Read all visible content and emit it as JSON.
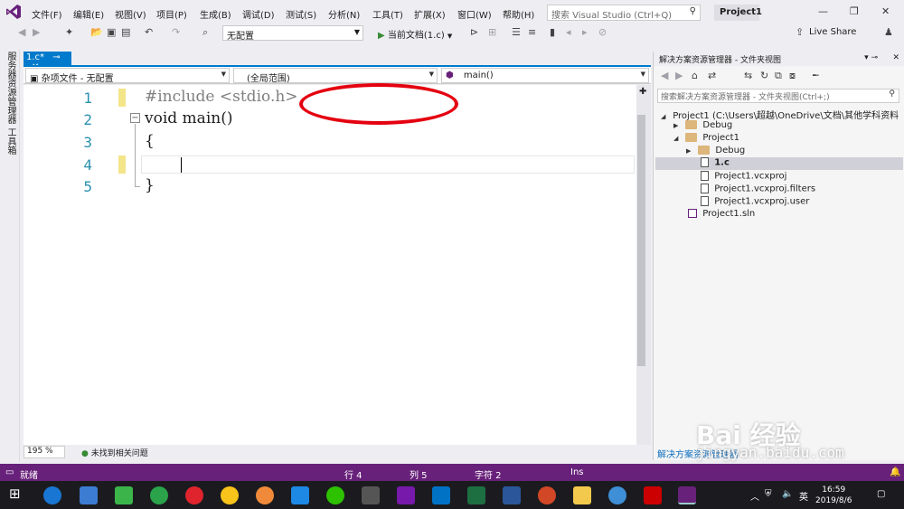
{
  "menubar": {
    "items": [
      "文件(F)",
      "编辑(E)",
      "视图(V)",
      "项目(P)",
      "生成(B)",
      "调试(D)",
      "测试(S)",
      "分析(N)",
      "工具(T)",
      "扩展(X)",
      "窗口(W)",
      "帮助(H)"
    ],
    "search_placeholder": "搜索 Visual Studio (Ctrl+Q)",
    "project_name": "Project1"
  },
  "toolbar": {
    "config": "无配置",
    "run_label": "当前文档(1.c)",
    "live_share": "Live Share"
  },
  "left_tabs": [
    "服务器资源管理器",
    "工具箱"
  ],
  "editor": {
    "tab_label": "1.c*",
    "nav_project": "杂项文件 - 无配置",
    "nav_scope": "(全局范围)",
    "nav_member": "main()",
    "lines": [
      {
        "num": "1",
        "text": "#include <stdio.h>"
      },
      {
        "num": "2",
        "text": "void main()"
      },
      {
        "num": "3",
        "text": "{"
      },
      {
        "num": "4",
        "text": ""
      },
      {
        "num": "5",
        "text": "}"
      }
    ],
    "zoom": "195 %",
    "issues": "未找到相关问题"
  },
  "solution_explorer": {
    "title": "解决方案资源管理器 - 文件夹视图",
    "search_placeholder": "搜索解决方案资源管理器 - 文件夹视图(Ctrl+;)",
    "tree": [
      {
        "label": "Project1 (C:\\Users\\超越\\OneDrive\\文档\\其他学科资料",
        "type": "proj"
      },
      {
        "label": "Debug",
        "type": "folder"
      },
      {
        "label": "Project1",
        "type": "folder"
      },
      {
        "label": "Debug",
        "type": "folder"
      },
      {
        "label": "1.c",
        "type": "file"
      },
      {
        "label": "Project1.vcxproj",
        "type": "file"
      },
      {
        "label": "Project1.vcxproj.filters",
        "type": "file"
      },
      {
        "label": "Project1.vcxproj.user",
        "type": "file"
      },
      {
        "label": "Project1.sln",
        "type": "sln"
      }
    ],
    "bottom_tab": "解决方案资源管理器"
  },
  "statusbar": {
    "ready": "就绪",
    "line": "行 4",
    "col": "列 5",
    "char": "字符 2",
    "ins": "Ins"
  },
  "taskbar": {
    "ime": "英",
    "time": "16:59",
    "date": "2019/8/6"
  },
  "watermark": {
    "brand": "Bai 经验",
    "url": "jingyan.baidu.com"
  },
  "colors": {
    "accent": "#007acc",
    "status": "#68217a",
    "annotation": "#e4000f"
  }
}
